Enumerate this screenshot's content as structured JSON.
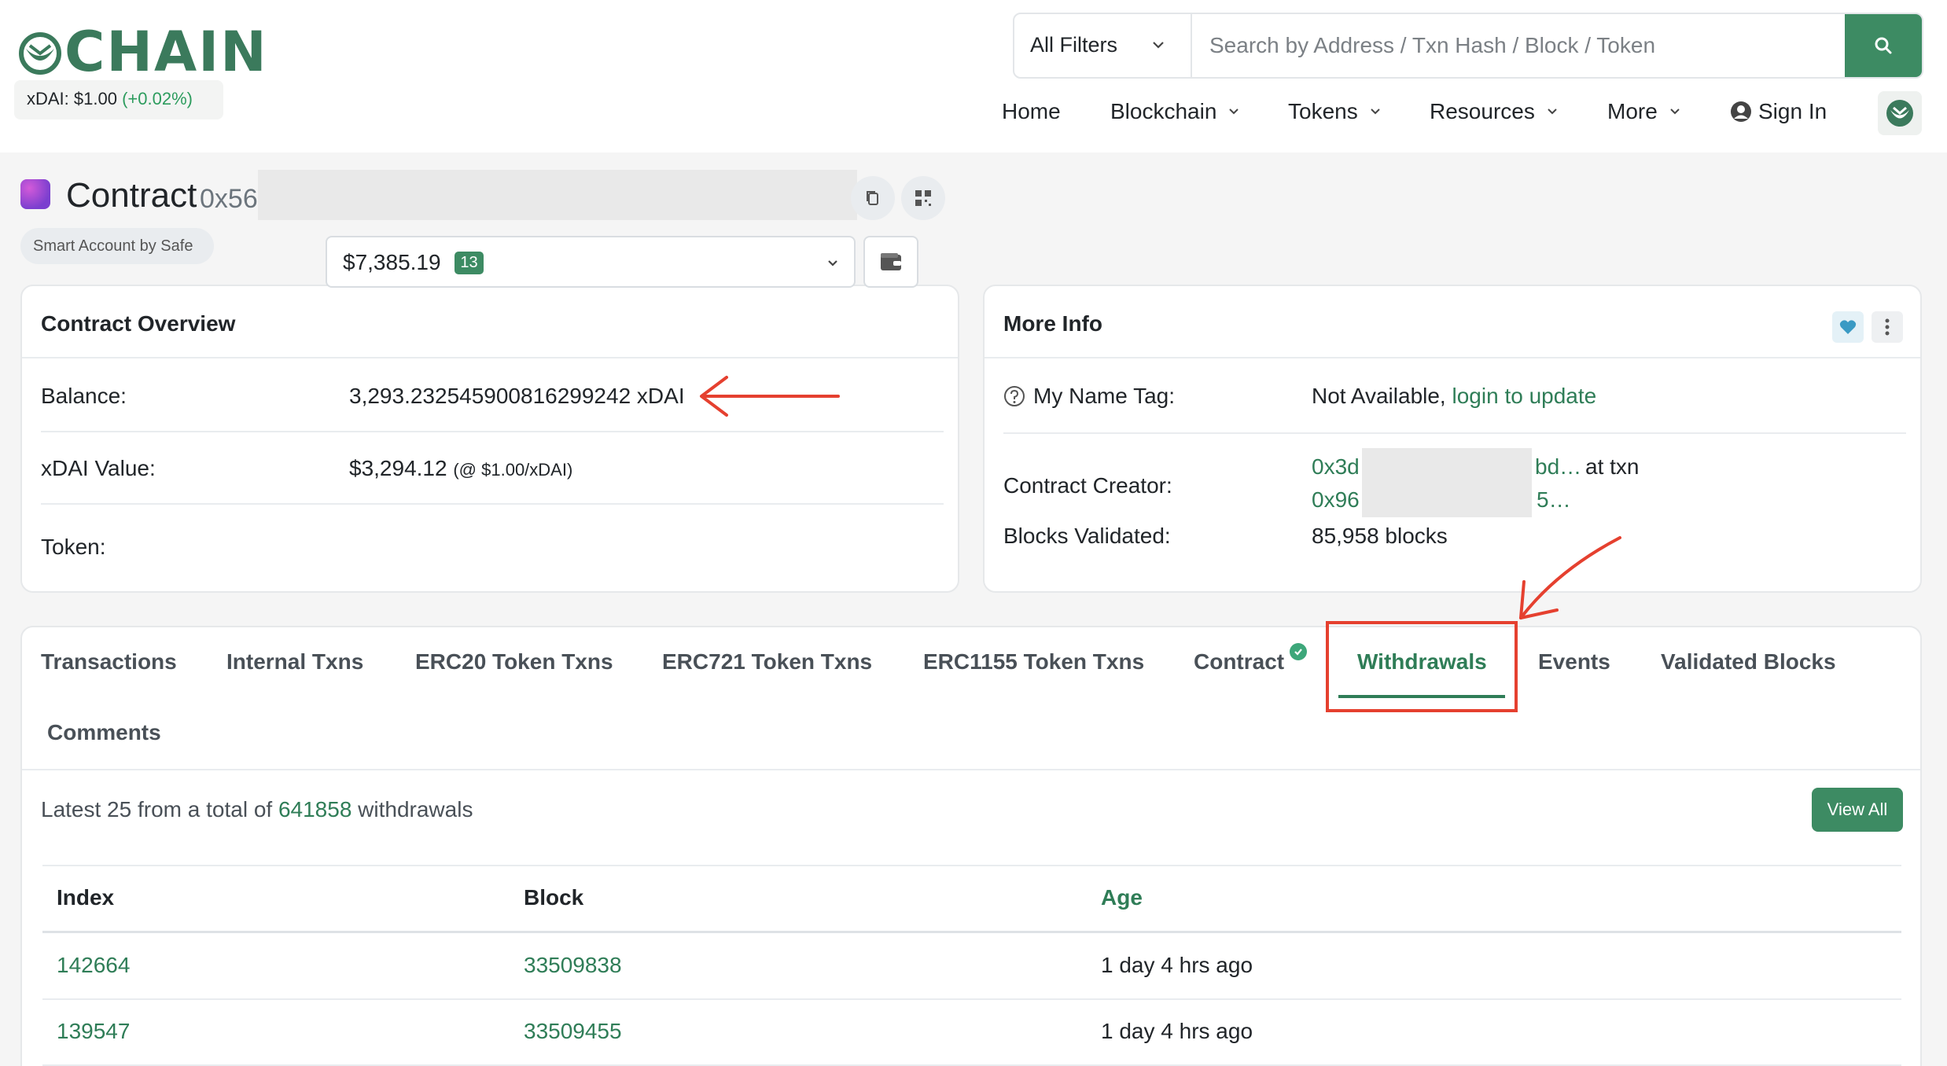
{
  "header": {
    "logo_text": "CHAIN",
    "price_label": "xDAI: $1.00",
    "price_change": "(+0.02%)",
    "filter": "All Filters",
    "search_placeholder": "Search by Address / Txn Hash / Block / Token"
  },
  "nav": {
    "items": [
      {
        "label": "Home",
        "dropdown": false
      },
      {
        "label": "Blockchain",
        "dropdown": true
      },
      {
        "label": "Tokens",
        "dropdown": true
      },
      {
        "label": "Resources",
        "dropdown": true
      },
      {
        "label": "More",
        "dropdown": true
      }
    ],
    "sign_in": "Sign In"
  },
  "contract": {
    "title": "Contract",
    "address_prefix": "0x56",
    "badge": "Smart Account by Safe"
  },
  "overview": {
    "title": "Contract Overview",
    "balance_label": "Balance:",
    "balance_value": "3,293.232545900816299242 xDAI",
    "value_label": "xDAI Value:",
    "value_amount": "$3,294.12",
    "value_rate": "(@ $1.00/xDAI)",
    "token_label": "Token:",
    "token_value": "$7,385.19",
    "token_count": "13"
  },
  "more_info": {
    "title": "More Info",
    "name_tag_label": "My Name Tag:",
    "name_tag_value": "Not Available,",
    "name_tag_link": "login to update",
    "creator_label": "Contract Creator:",
    "creator_addr_start": "0x3d",
    "creator_addr_end": "bd…",
    "creator_at_txn": "at txn",
    "creator_txn_start": "0x96",
    "creator_txn_end": "5…",
    "blocks_label": "Blocks Validated:",
    "blocks_value": "85,958 blocks"
  },
  "tabs": {
    "items": [
      "Transactions",
      "Internal Txns",
      "ERC20 Token Txns",
      "ERC721 Token Txns",
      "ERC1155 Token Txns",
      "Contract",
      "Withdrawals",
      "Events",
      "Validated Blocks",
      "Comments"
    ],
    "active": "Withdrawals"
  },
  "withdrawals": {
    "summary_prefix": "Latest 25 from a total of",
    "total": "641858",
    "summary_suffix": "withdrawals",
    "view_all": "View All",
    "columns": [
      "Index",
      "Block",
      "Age"
    ],
    "rows": [
      {
        "index": "142664",
        "block": "33509838",
        "age": "1 day 4 hrs ago"
      },
      {
        "index": "139547",
        "block": "33509455",
        "age": "1 day 4 hrs ago"
      }
    ]
  },
  "colors": {
    "brand_green": "#3d8b63",
    "link_green": "#2f7d57",
    "annotation_red": "#e5402f"
  },
  "icons": [
    "owl-logo-icon",
    "chevron-down-icon",
    "search-icon",
    "user-circle-icon",
    "copy-icon",
    "qr-code-icon",
    "wallet-icon",
    "help-circle-icon",
    "heart-icon",
    "kebab-icon",
    "verified-check-icon"
  ]
}
